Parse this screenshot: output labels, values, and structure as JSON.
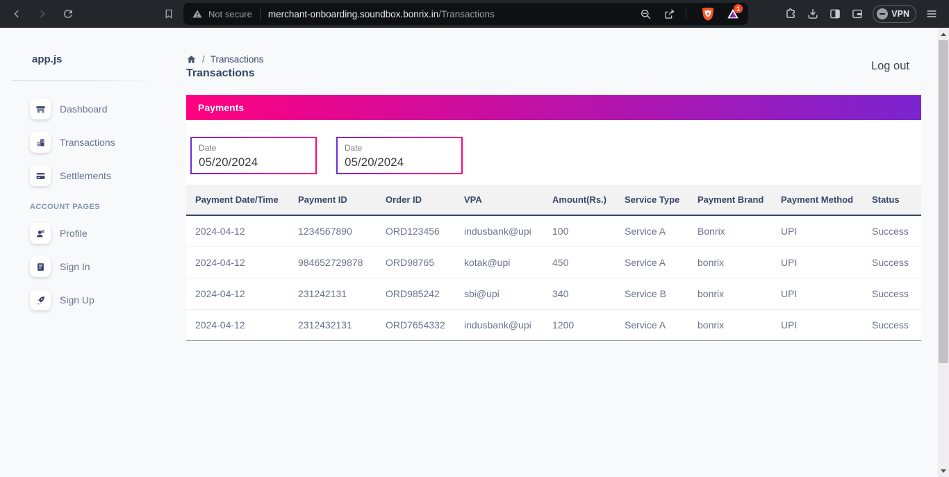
{
  "browser": {
    "security_label": "Not secure",
    "url_host": "merchant-onboarding.soundbox.bonrix.in",
    "url_path": "/Transactions",
    "rewards_badge": "1",
    "vpn_label": "VPN"
  },
  "sidebar": {
    "brand": "app.js",
    "items": [
      {
        "label": "Dashboard",
        "icon": "shop-icon"
      },
      {
        "label": "Transactions",
        "icon": "office-icon"
      },
      {
        "label": "Settlements",
        "icon": "credit-card-icon"
      }
    ],
    "section_title": "ACCOUNT PAGES",
    "account_items": [
      {
        "label": "Profile",
        "icon": "person-icon"
      },
      {
        "label": "Sign In",
        "icon": "document-icon"
      },
      {
        "label": "Sign Up",
        "icon": "rocket-icon"
      }
    ]
  },
  "header": {
    "breadcrumb_current": "Transactions",
    "page_title": "Transactions",
    "logout_label": "Log out"
  },
  "payments_panel": {
    "title": "Payments",
    "gradient_from": "#ff0080",
    "gradient_to": "#7b24cf"
  },
  "filters": {
    "from": {
      "label": "Date",
      "value": "05/20/2024"
    },
    "to": {
      "label": "Date",
      "value": "05/20/2024"
    }
  },
  "table": {
    "columns": [
      "Payment Date/Time",
      "Payment ID",
      "Order ID",
      "VPA",
      "Amount(Rs.)",
      "Service Type",
      "Payment Brand",
      "Payment Method",
      "Status"
    ],
    "rows": [
      [
        "2024-04-12",
        "1234567890",
        "ORD123456",
        "indusbank@upi",
        "100",
        "Service A",
        "Bonrix",
        "UPI",
        "Success"
      ],
      [
        "2024-04-12",
        "984652729878",
        "ORD98765",
        "kotak@upi",
        "450",
        "Service A",
        "bonrix",
        "UPI",
        "Success"
      ],
      [
        "2024-04-12",
        "231242131",
        "ORD985242",
        "sbi@upi",
        "340",
        "Service B",
        "bonrix",
        "UPI",
        "Success"
      ],
      [
        "2024-04-12",
        "2312432131",
        "ORD7654332",
        "indusbank@upi",
        "1200",
        "Service A",
        "bonrix",
        "UPI",
        "Success"
      ]
    ]
  }
}
